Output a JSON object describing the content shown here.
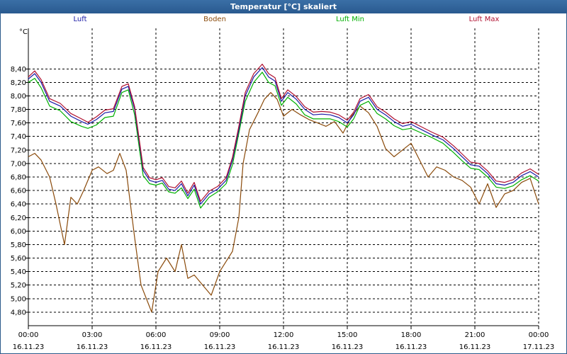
{
  "window": {
    "title": "Temperatur [°C] skaliert"
  },
  "chart_data": {
    "type": "line",
    "title": "Temperatur [°C] skaliert",
    "ylabel": "°C",
    "ylim": [
      4.6,
      9.0
    ],
    "yticks": [
      "4,80",
      "5,00",
      "5,20",
      "5,40",
      "5,60",
      "5,80",
      "6,00",
      "6,20",
      "6,40",
      "6,60",
      "6,80",
      "7,00",
      "7,20",
      "7,40",
      "7,60",
      "7,80",
      "8,00",
      "8,20",
      "8,40"
    ],
    "xlim": [
      0,
      24
    ],
    "xticks": [
      {
        "time": "00:00",
        "date": "16.11.23"
      },
      {
        "time": "03:00",
        "date": "16.11.23"
      },
      {
        "time": "06:00",
        "date": "16.11.23"
      },
      {
        "time": "09:00",
        "date": "16.11.23"
      },
      {
        "time": "12:00",
        "date": "16.11.23"
      },
      {
        "time": "15:00",
        "date": "16.11.23"
      },
      {
        "time": "18:00",
        "date": "16.11.23"
      },
      {
        "time": "21:00",
        "date": "16.11.23"
      },
      {
        "time": "00:00",
        "date": "17.11.23"
      }
    ],
    "grid": true,
    "legend_position": "top",
    "series": [
      {
        "name": "Luft",
        "color": "#1a1aa6",
        "points": [
          [
            0,
            8.25
          ],
          [
            0.3,
            8.33
          ],
          [
            0.6,
            8.2
          ],
          [
            1.0,
            7.92
          ],
          [
            1.5,
            7.85
          ],
          [
            2.0,
            7.7
          ],
          [
            2.5,
            7.62
          ],
          [
            2.8,
            7.58
          ],
          [
            3.2,
            7.65
          ],
          [
            3.6,
            7.75
          ],
          [
            4.0,
            7.77
          ],
          [
            4.4,
            8.1
          ],
          [
            4.7,
            8.14
          ],
          [
            5.0,
            7.8
          ],
          [
            5.4,
            6.9
          ],
          [
            5.7,
            6.75
          ],
          [
            6.0,
            6.72
          ],
          [
            6.3,
            6.75
          ],
          [
            6.6,
            6.62
          ],
          [
            6.9,
            6.6
          ],
          [
            7.2,
            6.7
          ],
          [
            7.5,
            6.52
          ],
          [
            7.8,
            6.68
          ],
          [
            8.1,
            6.4
          ],
          [
            8.5,
            6.55
          ],
          [
            8.9,
            6.62
          ],
          [
            9.3,
            6.75
          ],
          [
            9.6,
            7.05
          ],
          [
            9.9,
            7.5
          ],
          [
            10.2,
            8.0
          ],
          [
            10.6,
            8.28
          ],
          [
            11.0,
            8.42
          ],
          [
            11.3,
            8.28
          ],
          [
            11.6,
            8.22
          ],
          [
            11.9,
            7.92
          ],
          [
            12.2,
            8.05
          ],
          [
            12.6,
            7.95
          ],
          [
            13.0,
            7.8
          ],
          [
            13.4,
            7.72
          ],
          [
            13.8,
            7.73
          ],
          [
            14.2,
            7.72
          ],
          [
            14.6,
            7.68
          ],
          [
            15.0,
            7.6
          ],
          [
            15.3,
            7.72
          ],
          [
            15.6,
            7.92
          ],
          [
            16.0,
            7.98
          ],
          [
            16.4,
            7.8
          ],
          [
            16.8,
            7.72
          ],
          [
            17.2,
            7.62
          ],
          [
            17.6,
            7.55
          ],
          [
            18.0,
            7.58
          ],
          [
            18.5,
            7.5
          ],
          [
            19.0,
            7.42
          ],
          [
            19.5,
            7.35
          ],
          [
            20.0,
            7.22
          ],
          [
            20.4,
            7.1
          ],
          [
            20.8,
            6.98
          ],
          [
            21.2,
            6.96
          ],
          [
            21.6,
            6.85
          ],
          [
            22.0,
            6.7
          ],
          [
            22.4,
            6.68
          ],
          [
            22.8,
            6.72
          ],
          [
            23.2,
            6.82
          ],
          [
            23.6,
            6.88
          ],
          [
            24.0,
            6.8
          ]
        ]
      },
      {
        "name": "Boden",
        "color": "#8a4a0a",
        "points": [
          [
            0,
            7.1
          ],
          [
            0.3,
            7.15
          ],
          [
            0.6,
            7.05
          ],
          [
            1.0,
            6.8
          ],
          [
            1.3,
            6.4
          ],
          [
            1.7,
            5.8
          ],
          [
            2.0,
            6.5
          ],
          [
            2.3,
            6.4
          ],
          [
            2.6,
            6.6
          ],
          [
            3.0,
            6.9
          ],
          [
            3.3,
            6.95
          ],
          [
            3.7,
            6.85
          ],
          [
            4.0,
            6.9
          ],
          [
            4.3,
            7.15
          ],
          [
            4.6,
            6.9
          ],
          [
            5.0,
            5.9
          ],
          [
            5.3,
            5.2
          ],
          [
            5.8,
            4.8
          ],
          [
            6.1,
            5.4
          ],
          [
            6.5,
            5.6
          ],
          [
            6.9,
            5.4
          ],
          [
            7.2,
            5.8
          ],
          [
            7.5,
            5.3
          ],
          [
            7.8,
            5.35
          ],
          [
            8.2,
            5.2
          ],
          [
            8.6,
            5.05
          ],
          [
            9.0,
            5.4
          ],
          [
            9.3,
            5.55
          ],
          [
            9.6,
            5.7
          ],
          [
            9.9,
            6.2
          ],
          [
            10.1,
            7.0
          ],
          [
            10.4,
            7.5
          ],
          [
            10.8,
            7.75
          ],
          [
            11.1,
            7.95
          ],
          [
            11.4,
            8.05
          ],
          [
            11.7,
            7.95
          ],
          [
            12.0,
            7.7
          ],
          [
            12.4,
            7.8
          ],
          [
            12.8,
            7.72
          ],
          [
            13.2,
            7.65
          ],
          [
            13.6,
            7.6
          ],
          [
            14.0,
            7.55
          ],
          [
            14.4,
            7.62
          ],
          [
            14.8,
            7.45
          ],
          [
            15.2,
            7.7
          ],
          [
            15.6,
            7.85
          ],
          [
            16.0,
            7.75
          ],
          [
            16.4,
            7.55
          ],
          [
            16.8,
            7.22
          ],
          [
            17.2,
            7.1
          ],
          [
            17.6,
            7.2
          ],
          [
            18.0,
            7.3
          ],
          [
            18.4,
            7.05
          ],
          [
            18.8,
            6.8
          ],
          [
            19.2,
            6.95
          ],
          [
            19.6,
            6.9
          ],
          [
            20.0,
            6.8
          ],
          [
            20.4,
            6.75
          ],
          [
            20.8,
            6.65
          ],
          [
            21.2,
            6.4
          ],
          [
            21.6,
            6.7
          ],
          [
            22.0,
            6.35
          ],
          [
            22.4,
            6.55
          ],
          [
            22.8,
            6.6
          ],
          [
            23.2,
            6.72
          ],
          [
            23.6,
            6.78
          ],
          [
            24.0,
            6.4
          ]
        ]
      },
      {
        "name": "Luft Min",
        "color": "#00b000",
        "points": [
          [
            0,
            8.2
          ],
          [
            0.3,
            8.26
          ],
          [
            0.6,
            8.12
          ],
          [
            1.0,
            7.85
          ],
          [
            1.5,
            7.78
          ],
          [
            2.0,
            7.62
          ],
          [
            2.5,
            7.55
          ],
          [
            2.8,
            7.52
          ],
          [
            3.2,
            7.57
          ],
          [
            3.6,
            7.68
          ],
          [
            4.0,
            7.7
          ],
          [
            4.4,
            8.05
          ],
          [
            4.7,
            8.09
          ],
          [
            5.0,
            7.72
          ],
          [
            5.4,
            6.82
          ],
          [
            5.7,
            6.7
          ],
          [
            6.0,
            6.68
          ],
          [
            6.3,
            6.71
          ],
          [
            6.6,
            6.58
          ],
          [
            6.9,
            6.56
          ],
          [
            7.2,
            6.64
          ],
          [
            7.5,
            6.48
          ],
          [
            7.8,
            6.62
          ],
          [
            8.1,
            6.34
          ],
          [
            8.5,
            6.5
          ],
          [
            8.9,
            6.58
          ],
          [
            9.3,
            6.7
          ],
          [
            9.6,
            6.98
          ],
          [
            9.9,
            7.45
          ],
          [
            10.2,
            7.92
          ],
          [
            10.6,
            8.2
          ],
          [
            11.0,
            8.35
          ],
          [
            11.3,
            8.2
          ],
          [
            11.6,
            8.15
          ],
          [
            11.9,
            7.86
          ],
          [
            12.2,
            7.98
          ],
          [
            12.6,
            7.88
          ],
          [
            13.0,
            7.72
          ],
          [
            13.4,
            7.66
          ],
          [
            13.8,
            7.66
          ],
          [
            14.2,
            7.66
          ],
          [
            14.6,
            7.62
          ],
          [
            15.0,
            7.54
          ],
          [
            15.3,
            7.66
          ],
          [
            15.6,
            7.86
          ],
          [
            16.0,
            7.92
          ],
          [
            16.4,
            7.74
          ],
          [
            16.8,
            7.66
          ],
          [
            17.2,
            7.56
          ],
          [
            17.6,
            7.5
          ],
          [
            18.0,
            7.52
          ],
          [
            18.5,
            7.45
          ],
          [
            19.0,
            7.38
          ],
          [
            19.5,
            7.3
          ],
          [
            20.0,
            7.16
          ],
          [
            20.4,
            7.04
          ],
          [
            20.8,
            6.93
          ],
          [
            21.2,
            6.91
          ],
          [
            21.6,
            6.8
          ],
          [
            22.0,
            6.65
          ],
          [
            22.4,
            6.63
          ],
          [
            22.8,
            6.67
          ],
          [
            23.2,
            6.76
          ],
          [
            23.6,
            6.82
          ],
          [
            24.0,
            6.74
          ]
        ]
      },
      {
        "name": "Luft Max",
        "color": "#b01030",
        "points": [
          [
            0,
            8.28
          ],
          [
            0.3,
            8.37
          ],
          [
            0.6,
            8.24
          ],
          [
            1.0,
            7.96
          ],
          [
            1.5,
            7.89
          ],
          [
            2.0,
            7.74
          ],
          [
            2.5,
            7.66
          ],
          [
            2.8,
            7.61
          ],
          [
            3.2,
            7.69
          ],
          [
            3.6,
            7.79
          ],
          [
            4.0,
            7.81
          ],
          [
            4.4,
            8.14
          ],
          [
            4.7,
            8.18
          ],
          [
            5.0,
            7.84
          ],
          [
            5.4,
            6.94
          ],
          [
            5.7,
            6.79
          ],
          [
            6.0,
            6.76
          ],
          [
            6.3,
            6.79
          ],
          [
            6.6,
            6.66
          ],
          [
            6.9,
            6.64
          ],
          [
            7.2,
            6.74
          ],
          [
            7.5,
            6.56
          ],
          [
            7.8,
            6.72
          ],
          [
            8.1,
            6.44
          ],
          [
            8.5,
            6.59
          ],
          [
            8.9,
            6.66
          ],
          [
            9.3,
            6.79
          ],
          [
            9.6,
            7.09
          ],
          [
            9.9,
            7.55
          ],
          [
            10.2,
            8.05
          ],
          [
            10.6,
            8.33
          ],
          [
            11.0,
            8.47
          ],
          [
            11.3,
            8.33
          ],
          [
            11.6,
            8.27
          ],
          [
            11.9,
            7.96
          ],
          [
            12.2,
            8.09
          ],
          [
            12.6,
            7.99
          ],
          [
            13.0,
            7.84
          ],
          [
            13.4,
            7.76
          ],
          [
            13.8,
            7.77
          ],
          [
            14.2,
            7.76
          ],
          [
            14.6,
            7.72
          ],
          [
            15.0,
            7.64
          ],
          [
            15.3,
            7.76
          ],
          [
            15.6,
            7.96
          ],
          [
            16.0,
            8.02
          ],
          [
            16.4,
            7.84
          ],
          [
            16.8,
            7.76
          ],
          [
            17.2,
            7.66
          ],
          [
            17.6,
            7.59
          ],
          [
            18.0,
            7.62
          ],
          [
            18.5,
            7.54
          ],
          [
            19.0,
            7.46
          ],
          [
            19.5,
            7.39
          ],
          [
            20.0,
            7.26
          ],
          [
            20.4,
            7.14
          ],
          [
            20.8,
            7.02
          ],
          [
            21.2,
            7.0
          ],
          [
            21.6,
            6.89
          ],
          [
            22.0,
            6.74
          ],
          [
            22.4,
            6.72
          ],
          [
            22.8,
            6.76
          ],
          [
            23.2,
            6.86
          ],
          [
            23.6,
            6.92
          ],
          [
            24.0,
            6.84
          ]
        ]
      }
    ]
  }
}
